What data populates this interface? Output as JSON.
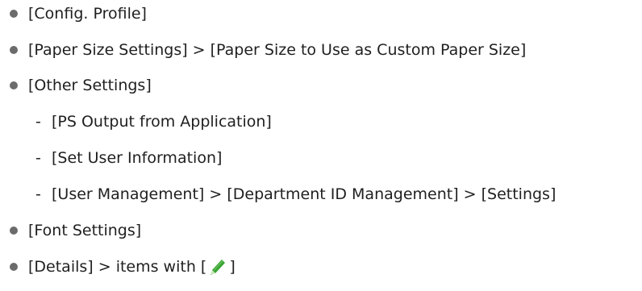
{
  "items": [
    {
      "level": 1,
      "text": "[Config. Profile]"
    },
    {
      "level": 1,
      "text": "[Paper Size Settings] > [Paper Size to Use as Custom Paper Size]"
    },
    {
      "level": 1,
      "text": "[Other Settings]"
    },
    {
      "level": 2,
      "text": "[PS Output from Application]"
    },
    {
      "level": 2,
      "text": "[Set User Information]"
    },
    {
      "level": 2,
      "text": "[User Management] > [Department ID Management] > [Settings]"
    },
    {
      "level": 1,
      "text": "[Font Settings]"
    },
    {
      "level": 1,
      "text_before_icon": "[Details] > items with [",
      "icon": "pencil-icon",
      "text_after_icon": "]"
    }
  ],
  "sub_marker": "-",
  "colors": {
    "text": "#1f1f1f",
    "bullet": "#6b6b6b",
    "pencil_body": "#3aa535",
    "pencil_tip": "#c8e6b8"
  }
}
